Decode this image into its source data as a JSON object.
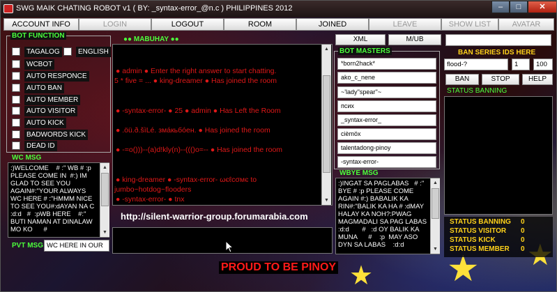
{
  "window": {
    "title": "SWG MAIK CHATING ROBOT v1  ( BY: _syntax-error_@n.c )  PHILIPPINES 2012",
    "min": "–",
    "max": "□",
    "close": "✕"
  },
  "tabs": [
    {
      "label": "ACCOUNT INFO"
    },
    {
      "label": "LOGIN"
    },
    {
      "label": "LOGOUT"
    },
    {
      "label": "ROOM"
    },
    {
      "label": "JOINED"
    },
    {
      "label": "LEAVE"
    },
    {
      "label": "SHOW LIST"
    },
    {
      "label": "AVATAR"
    }
  ],
  "bot_function": {
    "title": "BOT FUNCTION",
    "options": [
      {
        "label": "TAGALOG"
      },
      {
        "label": "ENGLISH"
      },
      {
        "label": "WCBOT"
      },
      {
        "label": "AUTO RESPONCE"
      },
      {
        "label": "AUTO BAN"
      },
      {
        "label": "AUTO MEMBER"
      },
      {
        "label": "AUTO VISITOR"
      },
      {
        "label": "AUTO KICK"
      },
      {
        "label": "BADWORDS KICK"
      },
      {
        "label": "DEAD ID"
      }
    ]
  },
  "wc_msg": {
    "title": "WC MSG",
    "text": ":)WELCOME    # :\" WB # :p PLEASE COME IN  #:) IM GLAD TO SEE YOU AGAIN#:\"YOUR ALWAYS WC HERE # :\"HMMM NICE TO SEE YOU#:dAYAN NA C :d:d   #  :pWB HERE    #:\" BUTI NAMAN AT DINALAW MO KO      #"
  },
  "pvt_msg": {
    "label": "PVT MSG",
    "value": "WC HERE IN OUR"
  },
  "chat": {
    "title": "●● MABUHAY ●●",
    "lines": [
      " ●  admin  ●  Enter the right answer to start chatting.",
      "5 * five = ... ● king-dreamer  ●  Has joined the room",
      " ●  -syntax-error-  ●  25 ● admin ●  Has Left the Room",
      " ● .öü.ð.šìLé. змáкьбóен. ●  Has joined the room",
      " ●  -=o()))--(a)d!kly(n)--((()o=--  ●  Has joined the room",
      " ●  king-dreamer  ●  -syntax-error-  ωєℓcσмє to",
      "jumbo~hotdog~flooders",
      " ●  -syntax-error-  ●  tnx"
    ],
    "url": "http://silent-warrior-group.forumarabia.com"
  },
  "masters": {
    "xml_label": "XML",
    "mub_label": "M/UB",
    "title": "BOT MASTERS",
    "items": [
      "*born2hack*",
      "ako_c_nene",
      "~'lady''spear''~",
      "псих",
      "_syntax-error_",
      "cièmöx",
      "talentadong-pinoy",
      "-syntax-error-"
    ]
  },
  "wbye_msg": {
    "title": "WBYE MSG",
    "text": ":)INGAT SA PAGLABAS   # :\" BYE # :p PLEASE COME AGAIN #:) BABALIK KA RIN#:\"BALIK KA HA # :dMAY HALAY KA NOH?:PWAG MAGMADALI SA PAG LABAS :d:d       #   :d OY BALIK KA MUNA      #    :p  MAY ASO DYN SA LABAS    :d:d"
  },
  "ban": {
    "title": "BAN SERIES IDS HERE",
    "id_field": "flood-?",
    "num1": "1",
    "num2": "100",
    "ban_label": "BAN",
    "stop_label": "STOP",
    "help_label": "HELP",
    "status_title": "STATUS BANNING"
  },
  "status": [
    {
      "label": "STATUS BANNING",
      "value": "0"
    },
    {
      "label": "STATUS VISITOR",
      "value": "0"
    },
    {
      "label": "STATUS KICK",
      "value": "0"
    },
    {
      "label": "STATUS MEMBER",
      "value": "0"
    }
  ],
  "banner": "PROUD TO BE PINOY",
  "colors": {
    "accent_green": "#4cff3c",
    "status_yellow": "#ffd21a",
    "chat_red": "#e01818"
  }
}
